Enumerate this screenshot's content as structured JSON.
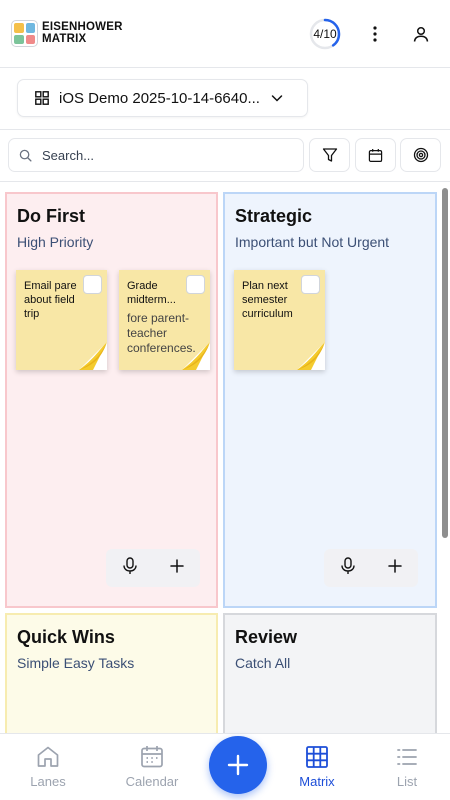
{
  "header": {
    "logo_line1": "EISENHOWER",
    "logo_line2": "MATRIX",
    "progress_text": "4/10",
    "progress_fraction": 0.4,
    "colors": {
      "logo_tl": "#f4c04a",
      "logo_tr": "#6fb8e0",
      "logo_bl": "#7cc49a",
      "logo_br": "#f08a8a",
      "progress": "#2563eb"
    }
  },
  "workspace": {
    "label": "iOS Demo 2025-10-14-6640...",
    "icon": "grid-icon"
  },
  "search": {
    "placeholder": "Search..."
  },
  "toolbar": {
    "filter_icon": "filter-icon",
    "calendar_icon": "calendar-icon",
    "focus_icon": "target-icon"
  },
  "quadrants": {
    "do_first": {
      "title": "Do First",
      "subtitle": "High Priority",
      "color": "#fdeef0",
      "notes": [
        {
          "text": "Email pare about field trip",
          "more": ""
        },
        {
          "text": "Grade midterm...",
          "more": "fore parent-teacher conferences."
        }
      ]
    },
    "strategic": {
      "title": "Strategic",
      "subtitle": "Important but Not Urgent",
      "color": "#eef4fd",
      "notes": [
        {
          "text": "Plan next semester curriculum",
          "more": ""
        }
      ]
    },
    "quick_wins": {
      "title": "Quick Wins",
      "subtitle": "Simple Easy Tasks",
      "color": "#fdfbe8"
    },
    "review": {
      "title": "Review",
      "subtitle": "Catch All",
      "color": "#f3f4f6"
    }
  },
  "nav": {
    "items": [
      {
        "label": "Lanes",
        "icon": "home-icon"
      },
      {
        "label": "Calendar",
        "icon": "calendar-icon"
      },
      {
        "label": "Matrix",
        "icon": "matrix-icon",
        "active": true
      },
      {
        "label": "List",
        "icon": "list-icon"
      }
    ],
    "fab_icon": "plus-icon",
    "accent": "#2563eb"
  }
}
